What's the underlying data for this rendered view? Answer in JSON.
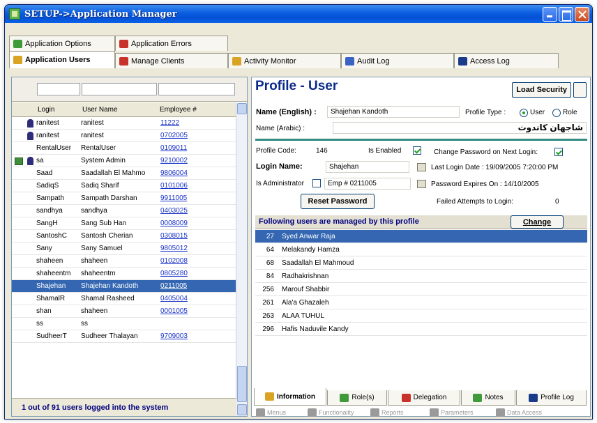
{
  "window": {
    "title": "SETUP->Application Manager",
    "accent": "#0550d6"
  },
  "tabs": {
    "row1": [
      {
        "label": "Application Options",
        "icon": "options-icon"
      },
      {
        "label": "Application Errors",
        "icon": "errors-icon"
      }
    ],
    "row2": [
      {
        "label": "Application Users",
        "icon": "users-icon"
      },
      {
        "label": "Manage Clients",
        "icon": "clients-icon"
      },
      {
        "label": "Activity Monitor",
        "icon": "activity-icon"
      },
      {
        "label": "Audit Log",
        "icon": "audit-icon"
      },
      {
        "label": "Access Log",
        "icon": "access-icon"
      }
    ]
  },
  "users_grid": {
    "columns": [
      "Login",
      "User Name",
      "Employee #"
    ],
    "rows": [
      {
        "login": "ranitest",
        "name": "ranitest",
        "emp": "11222",
        "key": true,
        "logged": false,
        "selected": false
      },
      {
        "login": "ranitest",
        "name": "ranitest",
        "emp": "0702005",
        "key": true,
        "logged": false,
        "selected": false
      },
      {
        "login": "RentalUser",
        "name": "RentalUser",
        "emp": "0109011",
        "key": false,
        "logged": false,
        "selected": false
      },
      {
        "login": "sa",
        "name": "System Admin",
        "emp": "9210002",
        "key": true,
        "logged": true,
        "selected": false
      },
      {
        "login": "Saad",
        "name": "Saadallah El Mahmo",
        "emp": "9806004",
        "key": false,
        "logged": false,
        "selected": false
      },
      {
        "login": "SadiqS",
        "name": "Sadiq Sharif",
        "emp": "0101006",
        "key": false,
        "logged": false,
        "selected": false
      },
      {
        "login": "Sampath",
        "name": "Sampath Darshan",
        "emp": "9911005",
        "key": false,
        "logged": false,
        "selected": false
      },
      {
        "login": "sandhya",
        "name": "sandhya",
        "emp": "0403025",
        "key": false,
        "logged": false,
        "selected": false
      },
      {
        "login": "SangH",
        "name": "Sang Sub Han",
        "emp": "0008009",
        "key": false,
        "logged": false,
        "selected": false
      },
      {
        "login": "SantoshC",
        "name": "Santosh Cherian",
        "emp": "0308015",
        "key": false,
        "logged": false,
        "selected": false
      },
      {
        "login": "Sany",
        "name": "Sany Samuel",
        "emp": "9805012",
        "key": false,
        "logged": false,
        "selected": false
      },
      {
        "login": "shaheen",
        "name": "shaheen",
        "emp": "0102008",
        "key": false,
        "logged": false,
        "selected": false
      },
      {
        "login": "shaheentm",
        "name": "shaheentm",
        "emp": "0805280",
        "key": false,
        "logged": false,
        "selected": false
      },
      {
        "login": "Shajehan",
        "name": "Shajehan Kandoth",
        "emp": "0211005",
        "key": false,
        "logged": false,
        "selected": true
      },
      {
        "login": "ShamalR",
        "name": "Shamal Rasheed",
        "emp": "0405004",
        "key": false,
        "logged": false,
        "selected": false
      },
      {
        "login": "shan",
        "name": "shaheen",
        "emp": "0001005",
        "key": false,
        "logged": false,
        "selected": false
      },
      {
        "login": "ss",
        "name": "ss",
        "emp": "",
        "key": false,
        "logged": false,
        "selected": false
      },
      {
        "login": "SudheerT",
        "name": "Sudheer Thalayan",
        "emp": "9709003",
        "key": false,
        "logged": false,
        "selected": false
      }
    ],
    "status": "1 out of 91 users logged into the system"
  },
  "profile": {
    "title": "Profile - User",
    "load_security": "Load Security",
    "name_english_label": "Name (English) :",
    "name_english": "Shajehan Kandoth",
    "profile_type_label": "Profile Type :",
    "type_user": "User",
    "type_role": "Role",
    "name_arabic_label": "Name (Arabic) :",
    "name_arabic": "شاجهان كاندوث",
    "profile_code_label": "Profile Code:",
    "profile_code": "146",
    "is_enabled_label": "Is Enabled",
    "change_pw_label": "Change Password on Next Login:",
    "login_name_label": "Login Name:",
    "login_name": "Shajehan",
    "last_login": "Last Login Date : 19/09/2005 7:20:00 PM",
    "is_admin_label": "Is Administrator",
    "emp_no": "Emp # 0211005",
    "pw_expires": "Password Expires On : 14/10/2005",
    "reset_password": "Reset Password",
    "failed_attempts_label": "Failed Attempts to Login:",
    "failed_attempts": "0"
  },
  "managed": {
    "header": "Following users are managed by this profile",
    "change": "Change",
    "rows": [
      {
        "id": "27",
        "name": "Syed Anwar Raja",
        "selected": true
      },
      {
        "id": "64",
        "name": "Melakandy Hamza",
        "selected": false
      },
      {
        "id": "68",
        "name": "Saadallah El Mahmoud",
        "selected": false
      },
      {
        "id": "84",
        "name": "Radhakrishnan",
        "selected": false
      },
      {
        "id": "256",
        "name": "Marouf Shabbir",
        "selected": false
      },
      {
        "id": "261",
        "name": "Ala'a Ghazaleh",
        "selected": false
      },
      {
        "id": "263",
        "name": "ALAA TUHUL",
        "selected": false
      },
      {
        "id": "296",
        "name": "Hafis Naduvile Kandy",
        "selected": false
      }
    ]
  },
  "bottom_tabs": [
    {
      "label": "Information",
      "icon": "info-icon"
    },
    {
      "label": "Role(s)",
      "icon": "roles-icon"
    },
    {
      "label": "Delegation",
      "icon": "delegation-icon"
    },
    {
      "label": "Notes",
      "icon": "notes-icon"
    },
    {
      "label": "Profile Log",
      "icon": "log-icon"
    }
  ],
  "sub_tabs": [
    "Menus",
    "Functionality",
    "Reports",
    "Parameters",
    "Data Access"
  ]
}
